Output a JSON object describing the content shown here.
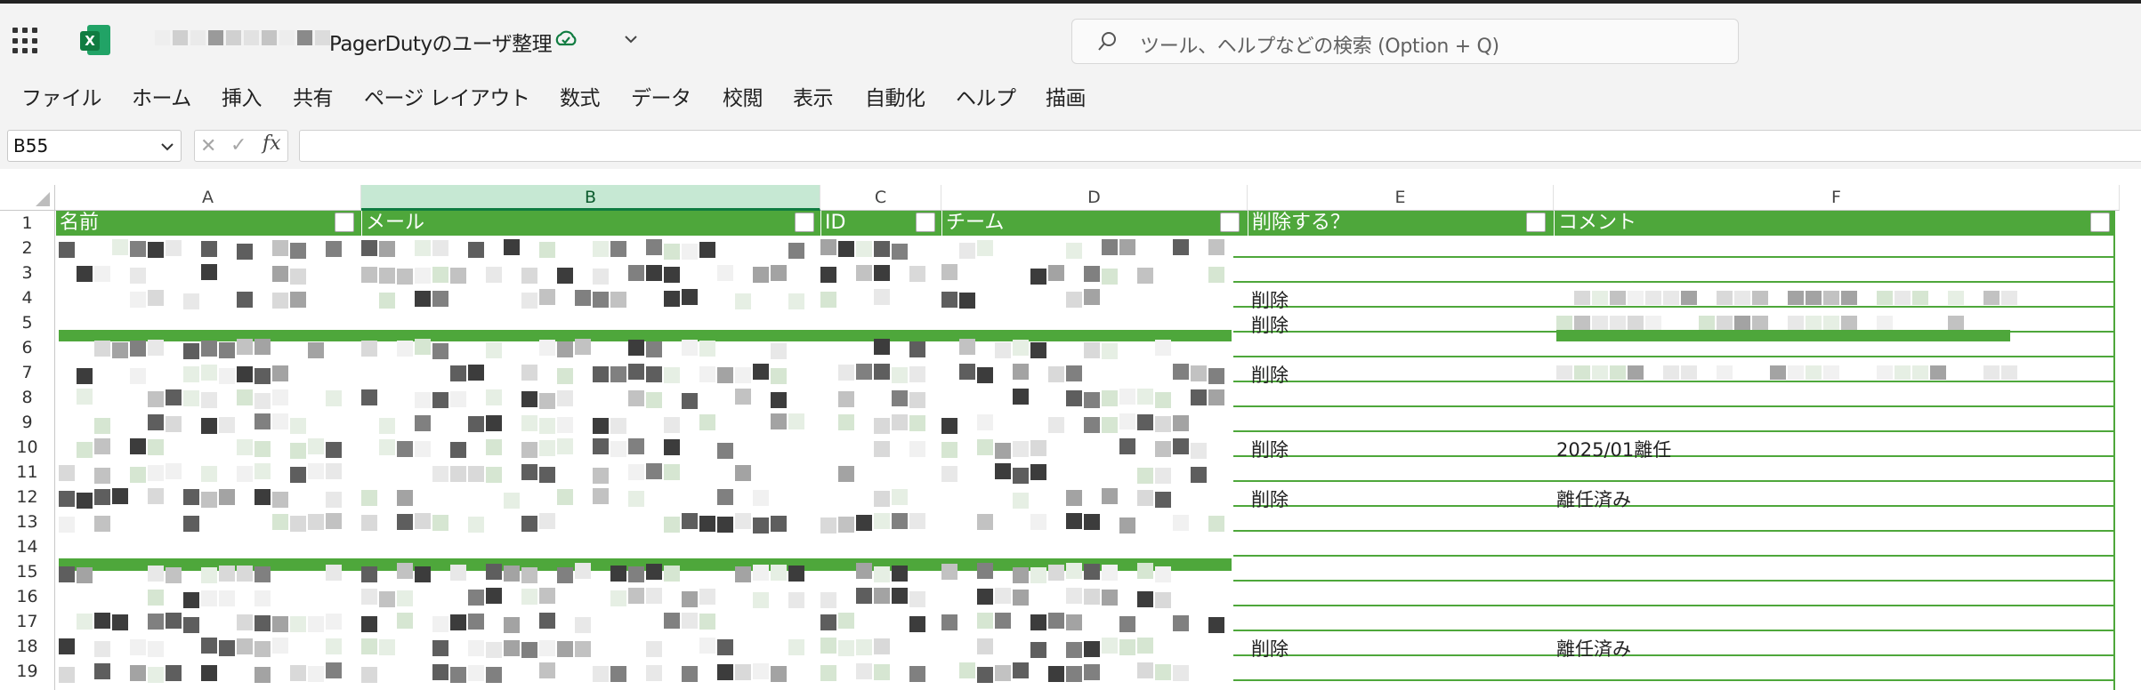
{
  "app": {
    "title": "PagerDutyのユーザ整理",
    "search_placeholder": "ツール、ヘルプなどの検索 (Option + Q)"
  },
  "menu": [
    "ファイル",
    "ホーム",
    "挿入",
    "共有",
    "ページ レイアウト",
    "数式",
    "データ",
    "校閲",
    "表示",
    "自動化",
    "ヘルプ",
    "描画"
  ],
  "formula_bar": {
    "name_box": "B55",
    "cancel": "✕",
    "enter": "✓",
    "fx": "fx",
    "formula": ""
  },
  "columns": [
    "A",
    "B",
    "C",
    "D",
    "E",
    "F"
  ],
  "selected_column": "B",
  "rows": [
    "1",
    "2",
    "3",
    "4",
    "5",
    "6",
    "7",
    "8",
    "9",
    "10",
    "11",
    "12",
    "13",
    "14",
    "15",
    "16",
    "17",
    "18",
    "19"
  ],
  "headers": [
    "名前",
    "メール",
    "ID",
    "チーム",
    "削除する？",
    "コメント"
  ],
  "cells": {
    "e4": "削除",
    "e5": "削除",
    "e7": "削除",
    "e10": "削除",
    "f10": "2025/01離任",
    "e12": "削除",
    "f12": "離任済み",
    "e18": "削除",
    "f18": "離任済み"
  },
  "colors": {
    "table_green": "#4ea73b",
    "excel_green": "#107c41",
    "selection": "#c6e8d3"
  }
}
